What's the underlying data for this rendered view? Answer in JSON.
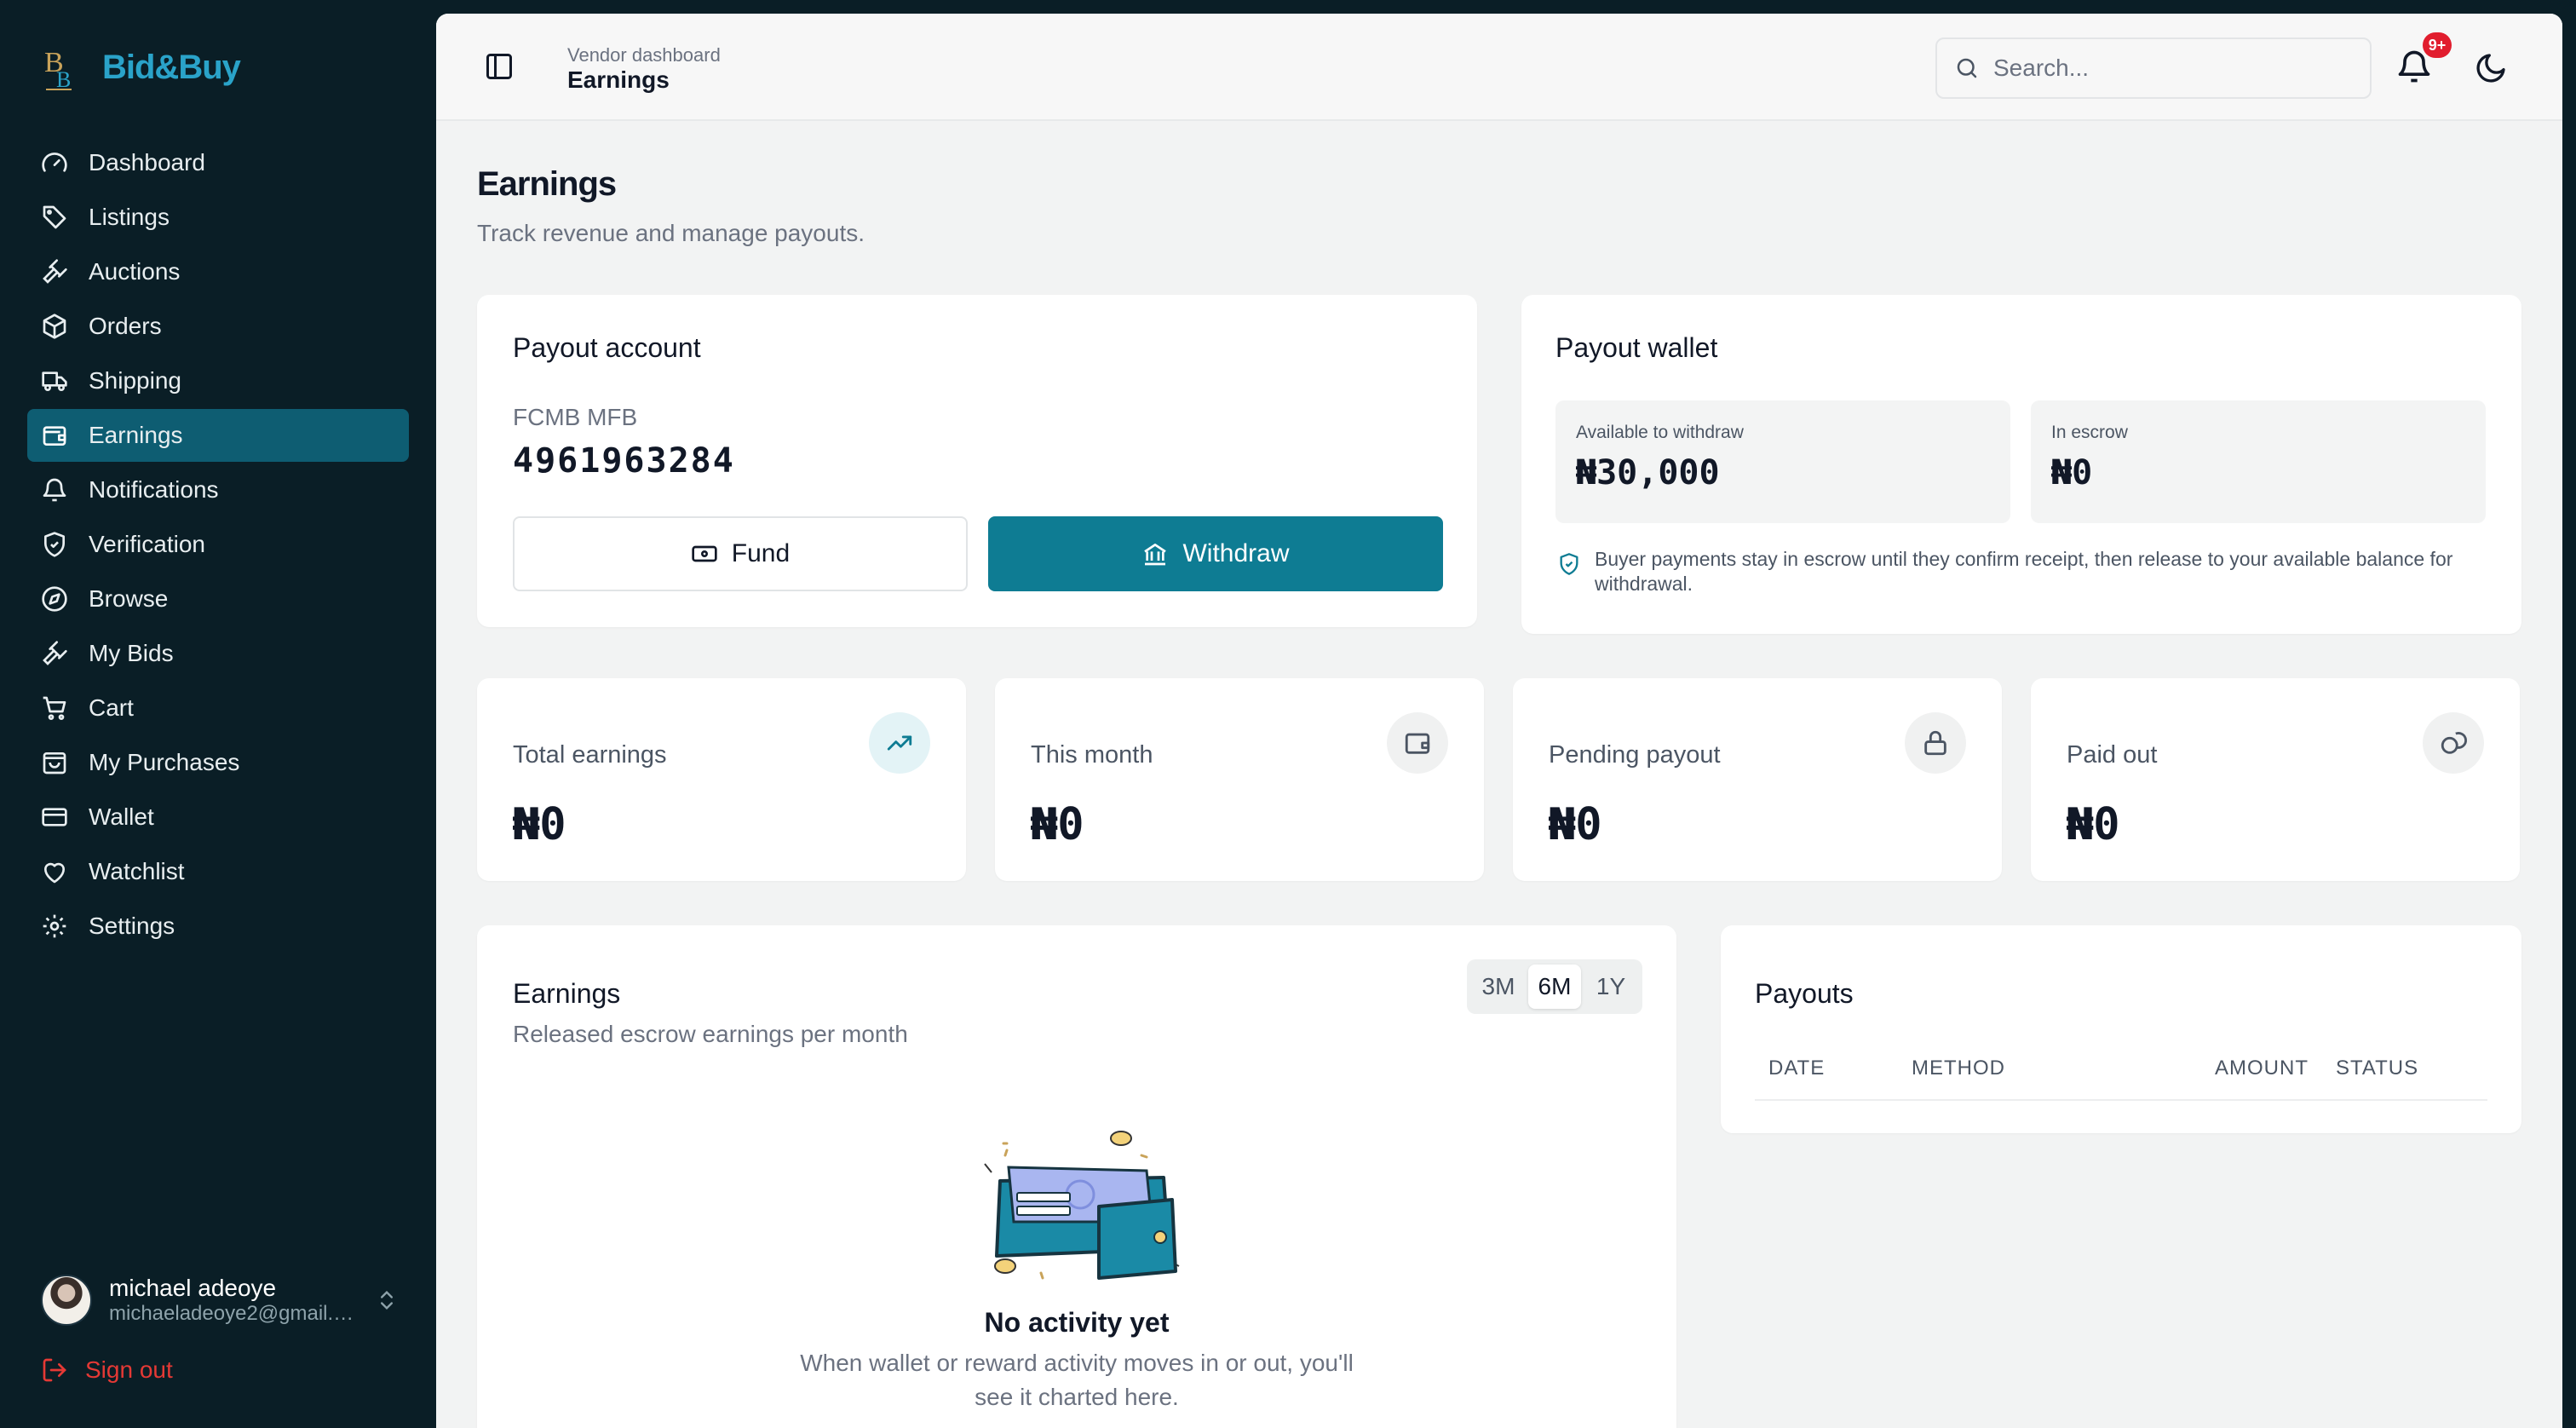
{
  "brand": {
    "name": "Bid&Buy",
    "accent": "#2aa3c9"
  },
  "sidebar": {
    "items": [
      {
        "label": "Dashboard",
        "icon": "gauge-icon"
      },
      {
        "label": "Listings",
        "icon": "tag-icon"
      },
      {
        "label": "Auctions",
        "icon": "gavel-icon"
      },
      {
        "label": "Orders",
        "icon": "package-icon"
      },
      {
        "label": "Shipping",
        "icon": "truck-icon"
      },
      {
        "label": "Earnings",
        "icon": "wallet-icon",
        "active": true
      },
      {
        "label": "Notifications",
        "icon": "bell-icon"
      },
      {
        "label": "Verification",
        "icon": "shield-check-icon"
      },
      {
        "label": "Browse",
        "icon": "compass-icon"
      },
      {
        "label": "My Bids",
        "icon": "gavel-icon"
      },
      {
        "label": "Cart",
        "icon": "cart-icon"
      },
      {
        "label": "My Purchases",
        "icon": "shopping-bag-icon"
      },
      {
        "label": "Wallet",
        "icon": "credit-card-icon"
      },
      {
        "label": "Watchlist",
        "icon": "heart-icon"
      },
      {
        "label": "Settings",
        "icon": "gear-icon"
      }
    ],
    "active_color": "#0e5d72"
  },
  "user": {
    "name": "michael adeoye",
    "email": "michaeladeoye2@gmail.c..."
  },
  "signout_label": "Sign out",
  "topbar": {
    "crumb_parent": "Vendor dashboard",
    "crumb_current": "Earnings",
    "search_placeholder": "Search...",
    "notification_badge": "9+"
  },
  "page": {
    "title": "Earnings",
    "subtitle": "Track revenue and manage payouts."
  },
  "payout_account": {
    "title": "Payout account",
    "bank": "FCMB MFB",
    "account_number": "4961963284",
    "fund_label": "Fund",
    "withdraw_label": "Withdraw",
    "primary_color": "#0e7c93"
  },
  "payout_wallet": {
    "title": "Payout wallet",
    "available_label": "Available to withdraw",
    "available_value": "₦30,000",
    "escrow_label": "In escrow",
    "escrow_value": "₦0",
    "note": "Buyer payments stay in escrow until they confirm receipt, then release to your available balance for withdrawal."
  },
  "stats": [
    {
      "label": "Total earnings",
      "value": "₦0",
      "icon": "trending-up-icon"
    },
    {
      "label": "This month",
      "value": "₦0",
      "icon": "wallet-icon"
    },
    {
      "label": "Pending payout",
      "value": "₦0",
      "icon": "lock-icon"
    },
    {
      "label": "Paid out",
      "value": "₦0",
      "icon": "coins-icon"
    }
  ],
  "earnings_chart": {
    "title": "Earnings",
    "subtitle": "Released escrow earnings per month",
    "ranges": [
      "3M",
      "6M",
      "1Y"
    ],
    "selected_range": "6M",
    "empty_title": "No activity yet",
    "empty_text": "When wallet or reward activity moves in or out, you'll see it charted here."
  },
  "payouts": {
    "title": "Payouts",
    "columns": [
      "DATE",
      "METHOD",
      "AMOUNT",
      "STATUS"
    ]
  }
}
